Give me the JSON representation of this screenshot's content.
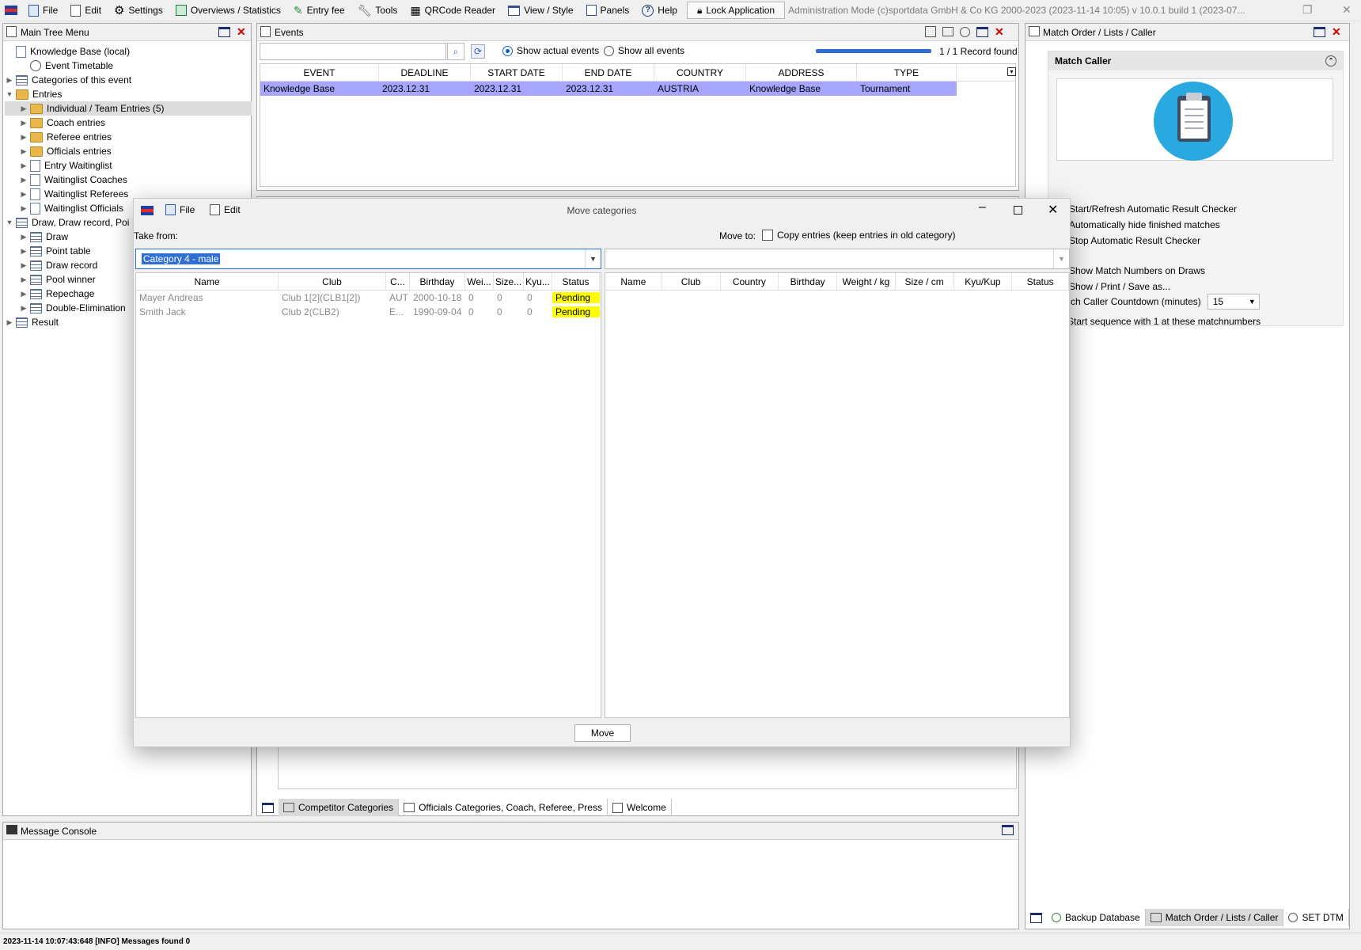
{
  "menubar": {
    "items": [
      {
        "label": "File",
        "icon": "file-icon"
      },
      {
        "label": "Edit",
        "icon": "edit-icon"
      },
      {
        "label": "Settings",
        "icon": "gear-icon"
      },
      {
        "label": "Overviews / Statistics",
        "icon": "statistics-icon"
      },
      {
        "label": "Entry fee",
        "icon": "money-icon"
      },
      {
        "label": "Tools",
        "icon": "wrench-icon"
      },
      {
        "label": "QRCode Reader",
        "icon": "qrcode-icon"
      },
      {
        "label": "View / Style",
        "icon": "view-icon"
      },
      {
        "label": "Panels",
        "icon": "panels-icon"
      },
      {
        "label": "Help",
        "icon": "help-icon"
      }
    ],
    "lock_label": "Lock Application",
    "admin_text": "Administration Mode (c)sportdata GmbH & Co KG 2000-2023 (2023-11-14 10:05)  v 10.0.1 build 1 (2023-07..."
  },
  "main_tree": {
    "title": "Main Tree Menu",
    "items": [
      {
        "label": "Knowledge Base (local)",
        "level": 0,
        "arrow": "",
        "icon": "database-icon"
      },
      {
        "label": "Event Timetable",
        "level": 1,
        "arrow": "",
        "icon": "clock-icon"
      },
      {
        "label": "Categories of this event",
        "level": 0,
        "arrow": "▶",
        "icon": "categories-icon"
      },
      {
        "label": "Entries",
        "level": 0,
        "arrow": "▼",
        "icon": "folder-icon"
      },
      {
        "label": "Individual / Team Entries (5)",
        "level": 1,
        "arrow": "▶",
        "icon": "folder-icon",
        "selected": true
      },
      {
        "label": "Coach entries",
        "level": 1,
        "arrow": "▶",
        "icon": "folder-icon"
      },
      {
        "label": "Referee entries",
        "level": 1,
        "arrow": "▶",
        "icon": "folder-icon"
      },
      {
        "label": "Officials entries",
        "level": 1,
        "arrow": "▶",
        "icon": "folder-icon"
      },
      {
        "label": "Entry Waitinglist",
        "level": 1,
        "arrow": "▶",
        "icon": "waitinglist-icon"
      },
      {
        "label": "Waitinglist Coaches",
        "level": 1,
        "arrow": "▶",
        "icon": "waitinglist-icon"
      },
      {
        "label": "Waitinglist Referees",
        "level": 1,
        "arrow": "▶",
        "icon": "waitinglist-icon"
      },
      {
        "label": "Waitinglist Officials",
        "level": 1,
        "arrow": "▶",
        "icon": "waitinglist-icon"
      },
      {
        "label": "Draw, Draw record, Poi",
        "level": 0,
        "arrow": "▼",
        "icon": "draw-icon"
      },
      {
        "label": "Draw",
        "level": 1,
        "arrow": "▶",
        "icon": "draw-icon"
      },
      {
        "label": "Point table",
        "level": 1,
        "arrow": "▶",
        "icon": "point-table-icon"
      },
      {
        "label": "Draw record",
        "level": 1,
        "arrow": "▶",
        "icon": "draw-record-icon"
      },
      {
        "label": "Pool winner",
        "level": 1,
        "arrow": "▶",
        "icon": "pool-winner-icon"
      },
      {
        "label": "Repechage",
        "level": 1,
        "arrow": "▶",
        "icon": "repechage-icon"
      },
      {
        "label": "Double-Elimination",
        "level": 1,
        "arrow": "▶",
        "icon": "double-elimination-icon"
      },
      {
        "label": "Result",
        "level": 0,
        "arrow": "▶",
        "icon": "result-icon"
      }
    ]
  },
  "events": {
    "title": "Events",
    "search_value": "",
    "radio_actual": "Show actual events",
    "radio_all": "Show all events",
    "records_found": "1 / 1 Record found",
    "columns": [
      "EVENT",
      "DEADLINE",
      "START DATE",
      "END DATE",
      "COUNTRY",
      "ADDRESS",
      "TYPE"
    ],
    "rows": [
      [
        "Knowledge Base",
        "2023.12.31",
        "2023.12.31",
        "2023.12.31",
        "AUSTRIA",
        "Knowledge Base",
        "Tournament"
      ]
    ],
    "bottom_tabs": [
      "Competitor Categories",
      "Officials Categories, Coach, Referee, Press",
      "Welcome"
    ]
  },
  "match_panel": {
    "title": "Match Order / Lists / Caller",
    "section_title": "Match Caller",
    "actions": [
      {
        "label": "Start/Refresh Automatic Result Checker",
        "icon": "search-refresh-icon"
      },
      {
        "label": "Automatically hide finished matches",
        "icon": "checkbox-checked-icon"
      },
      {
        "label": "Stop Automatic Result Checker",
        "icon": "stop-icon"
      },
      {
        "label": "Show Match Numbers on Draws",
        "icon": "checkbox-checked-icon"
      },
      {
        "label": "Show / Print / Save as...",
        "icon": "print-icon"
      }
    ],
    "countdown_label": "Match Caller Countdown (minutes)",
    "countdown_value": "15",
    "sequence_label": "Start sequence with 1 at these matchnumbers",
    "bottom_tabs": [
      "Backup Database",
      "Match Order / Lists / Caller",
      "SET DTM"
    ]
  },
  "console": {
    "title": "Message Console"
  },
  "status_bar": "2023-11-14 10:07:43:648 [INFO] Messages found 0",
  "dialog": {
    "title": "Move categories",
    "menu_file": "File",
    "menu_edit": "Edit",
    "take_from_label": "Take from:",
    "move_to_label": "Move to:",
    "copy_label": "Copy entries (keep entries in old category)",
    "from_combo_value": "Category 4 - male",
    "to_combo_value": "",
    "left_columns": [
      "Name",
      "Club",
      "C...",
      "Birthday",
      "Wei...",
      "Size...",
      "Kyu...",
      "Status"
    ],
    "left_rows": [
      [
        "Mayer Andreas",
        "Club 1[2](CLB1[2])",
        "AUT",
        "2000-10-18",
        "0",
        "0",
        "0",
        "Pending"
      ],
      [
        "Smith Jack",
        "Club 2(CLB2)",
        "E...",
        "1990-09-04",
        "0",
        "0",
        "0",
        "Pending"
      ]
    ],
    "right_columns": [
      "Name",
      "Club",
      "Country",
      "Birthday",
      "Weight / kg",
      "Size / cm",
      "Kyu/Kup",
      "Status"
    ],
    "move_button": "Move"
  },
  "colors": {
    "selection_row": "#a6a6ff",
    "pending": "#ffff00",
    "accent": "#0a64c8",
    "caller_circle": "#2aa9e0"
  }
}
